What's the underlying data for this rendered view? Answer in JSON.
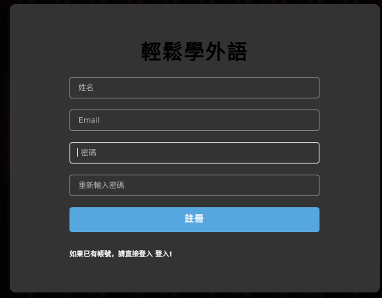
{
  "form": {
    "title": "輕鬆學外語",
    "fields": [
      {
        "placeholder": "姓名"
      },
      {
        "placeholder": "Email"
      },
      {
        "placeholder": "密碼"
      },
      {
        "placeholder": "重新輸入密碼"
      }
    ],
    "submit_label": "註冊",
    "footer_prefix": "如果已有帳號，請直接登入",
    "footer_link": "登入!"
  }
}
